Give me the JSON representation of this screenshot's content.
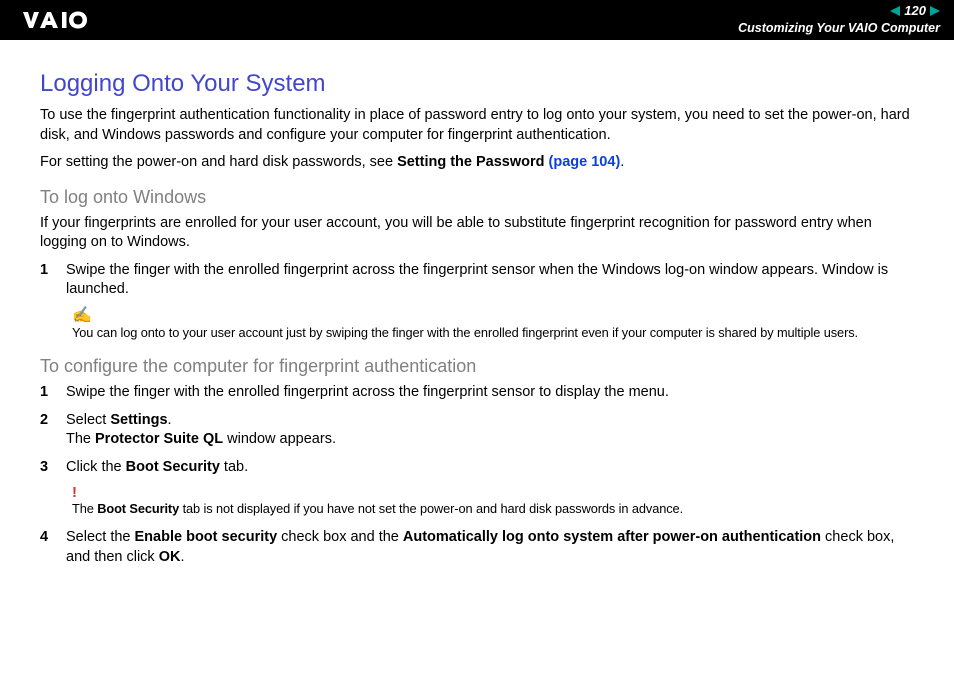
{
  "header": {
    "page_number": "120",
    "section": "Customizing Your VAIO Computer"
  },
  "title": "Logging Onto Your System",
  "intro1": "To use the fingerprint authentication functionality in place of password entry to log onto your system, you need to set the power-on, hard disk, and Windows passwords and configure your computer for fingerprint authentication.",
  "intro2_prefix": "For setting the power-on and hard disk passwords, see ",
  "intro2_bold": "Setting the Password",
  "intro2_link": "(page 104)",
  "intro2_suffix": ".",
  "sectionA": {
    "heading": "To log onto Windows",
    "para": "If your fingerprints are enrolled for your user account, you will be able to substitute fingerprint recognition for password entry when logging on to Windows.",
    "step1_num": "1",
    "step1_text": "Swipe the finger with the enrolled fingerprint across the fingerprint sensor when the Windows log-on window appears. Window is launched.",
    "note": "You can log onto to your user account just by swiping the finger with the enrolled fingerprint even if your computer is shared by multiple users."
  },
  "sectionB": {
    "heading": "To configure the computer for fingerprint authentication",
    "step1_num": "1",
    "step1_text": "Swipe the finger with the enrolled fingerprint across the fingerprint sensor to display the menu.",
    "step2_num": "2",
    "step2_pre": "Select ",
    "step2_b1": "Settings",
    "step2_mid": ".\nThe ",
    "step2_b2": "Protector Suite QL",
    "step2_post": " window appears.",
    "step3_num": "3",
    "step3_pre": " Click the ",
    "step3_b": "Boot Security",
    "step3_post": " tab.",
    "warn_pre": "The ",
    "warn_b": "Boot Security",
    "warn_post": " tab is not displayed if you have not set the power-on and hard disk passwords in advance.",
    "step4_num": "4",
    "step4_pre": "Select the ",
    "step4_b1": "Enable boot security",
    "step4_mid1": " check box and the ",
    "step4_b2": "Automatically log onto system after power-on authentication",
    "step4_mid2": " check box, and then click ",
    "step4_b3": "OK",
    "step4_post": "."
  }
}
